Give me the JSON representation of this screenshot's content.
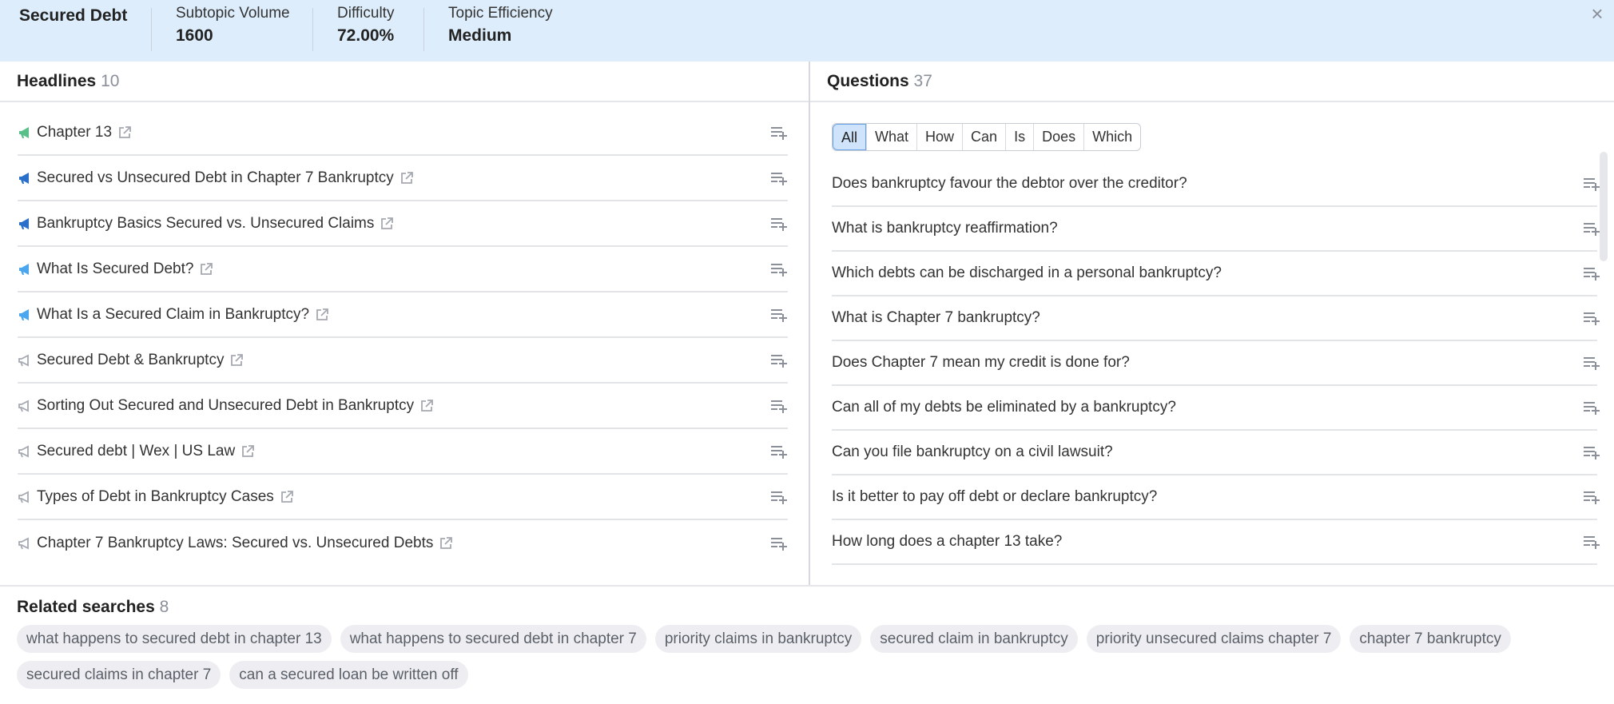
{
  "header": {
    "title": "Secured Debt",
    "stats": [
      {
        "label": "Subtopic Volume",
        "value": "1600"
      },
      {
        "label": "Difficulty",
        "value": "72.00%"
      },
      {
        "label": "Topic Efficiency",
        "value": "Medium"
      }
    ],
    "close_icon": "×"
  },
  "headlines": {
    "title": "Headlines",
    "count": "10",
    "items": [
      {
        "text": "Chapter 13",
        "icon_color": "#59c08a"
      },
      {
        "text": "Secured vs Unsecured Debt in Chapter 7 Bankruptcy",
        "icon_color": "#2a6fc9"
      },
      {
        "text": "Bankruptcy Basics Secured vs. Unsecured Claims",
        "icon_color": "#2a6fc9"
      },
      {
        "text": "What Is Secured Debt?",
        "icon_color": "#4aa6ee"
      },
      {
        "text": "What Is a Secured Claim in Bankruptcy?",
        "icon_color": "#4aa6ee"
      },
      {
        "text": "Secured Debt & Bankruptcy",
        "icon_color": "#a5a9b1"
      },
      {
        "text": "Sorting Out Secured and Unsecured Debt in Bankruptcy",
        "icon_color": "#a5a9b1"
      },
      {
        "text": "Secured debt | Wex | US Law",
        "icon_color": "#a5a9b1"
      },
      {
        "text": "Types of Debt in Bankruptcy Cases",
        "icon_color": "#a5a9b1"
      },
      {
        "text": "Chapter 7 Bankruptcy Laws: Secured vs. Unsecured Debts",
        "icon_color": "#a5a9b1"
      }
    ]
  },
  "questions": {
    "title": "Questions",
    "count": "37",
    "filters": [
      "All",
      "What",
      "How",
      "Can",
      "Is",
      "Does",
      "Which"
    ],
    "active_filter": "All",
    "items": [
      "Does bankruptcy favour the debtor over the creditor?",
      "What is bankruptcy reaffirmation?",
      "Which debts can be discharged in a personal bankruptcy?",
      "What is Chapter 7 bankruptcy?",
      "Does Chapter 7 mean my credit is done for?",
      "Can all of my debts be eliminated by a bankruptcy?",
      "Can you file bankruptcy on a civil lawsuit?",
      "Is it better to pay off debt or declare bankruptcy?",
      "How long does a chapter 13 take?"
    ]
  },
  "related": {
    "title": "Related searches",
    "count": "8",
    "items": [
      "what happens to secured debt in chapter 13",
      "what happens to secured debt in chapter 7",
      "priority claims in bankruptcy",
      "secured claim in bankruptcy",
      "priority unsecured claims chapter 7",
      "chapter 7 bankruptcy",
      "secured claims in chapter 7",
      "can a secured loan be written off"
    ]
  }
}
